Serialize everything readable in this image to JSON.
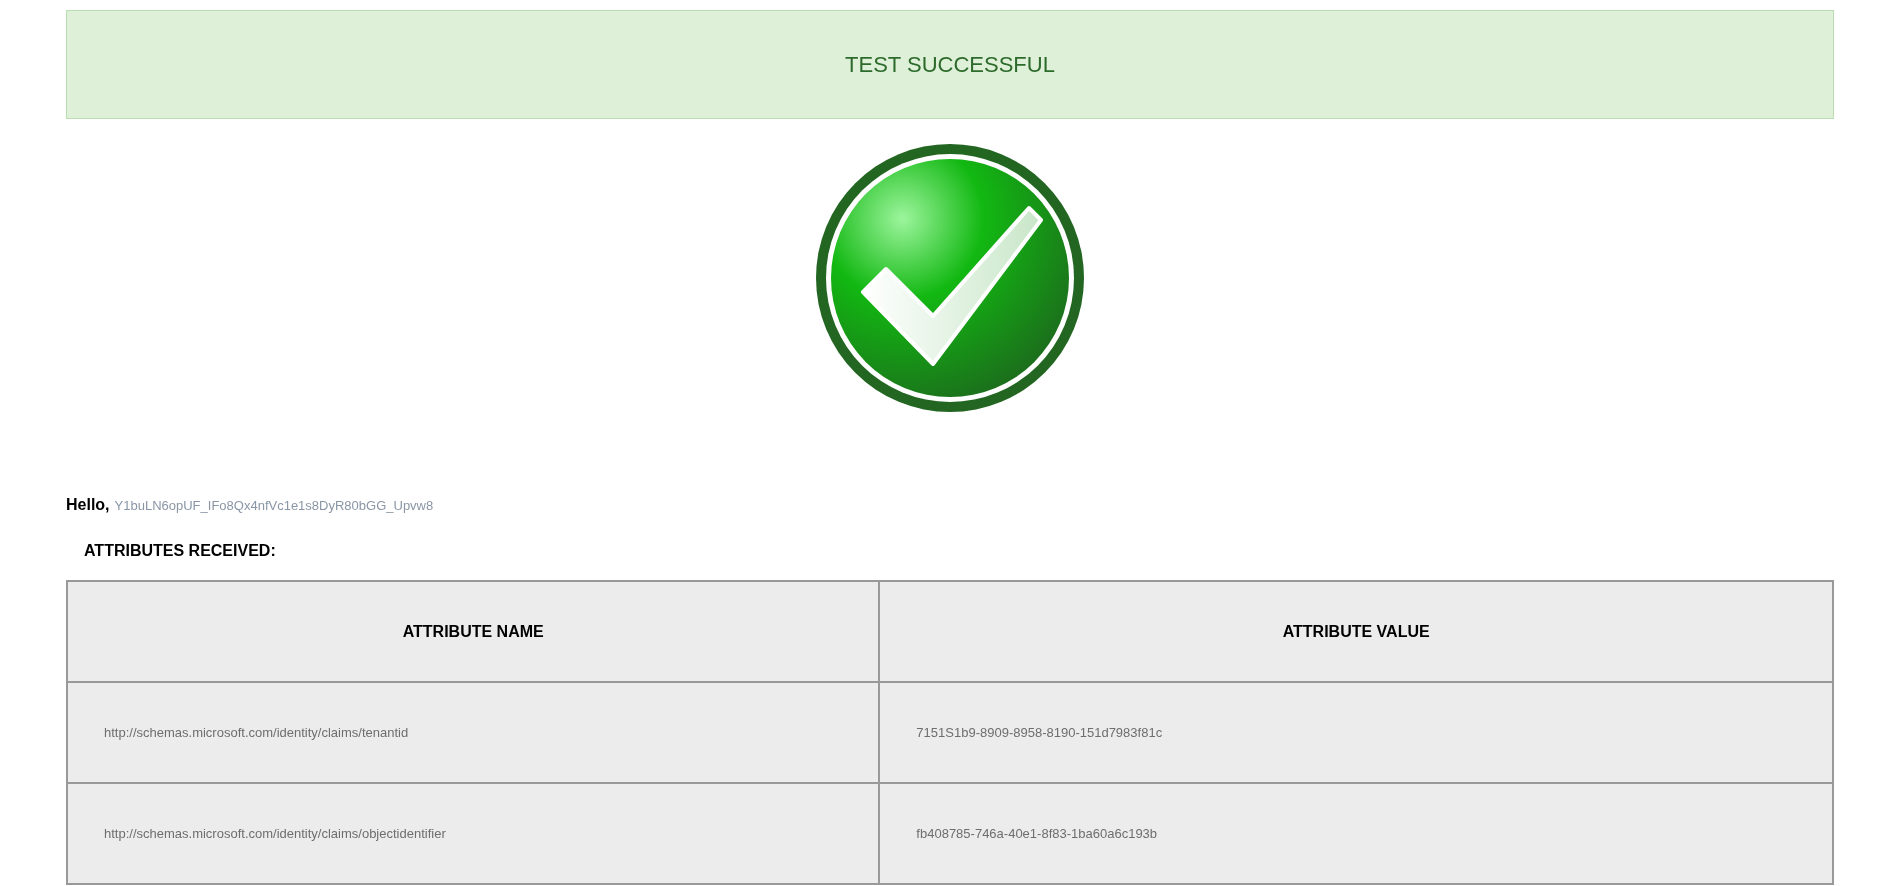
{
  "banner": {
    "text": "TEST SUCCESSFUL"
  },
  "greeting": {
    "label": "Hello,",
    "name": "Y1buLN6opUF_IFo8Qx4nfVc1e1s8DyR80bGG_Upvw8"
  },
  "section_title": "ATTRIBUTES RECEIVED:",
  "table": {
    "columns": [
      "ATTRIBUTE NAME",
      "ATTRIBUTE VALUE"
    ],
    "rows": [
      {
        "name": "http://schemas.microsoft.com/identity/claims/tenantid",
        "value": "7151S1b9-8909-8958-8190-151d7983f81c"
      },
      {
        "name": "http://schemas.microsoft.com/identity/claims/objectidentifier",
        "value": "fb408785-746a-40e1-8f83-1ba60a6c193b"
      }
    ]
  }
}
